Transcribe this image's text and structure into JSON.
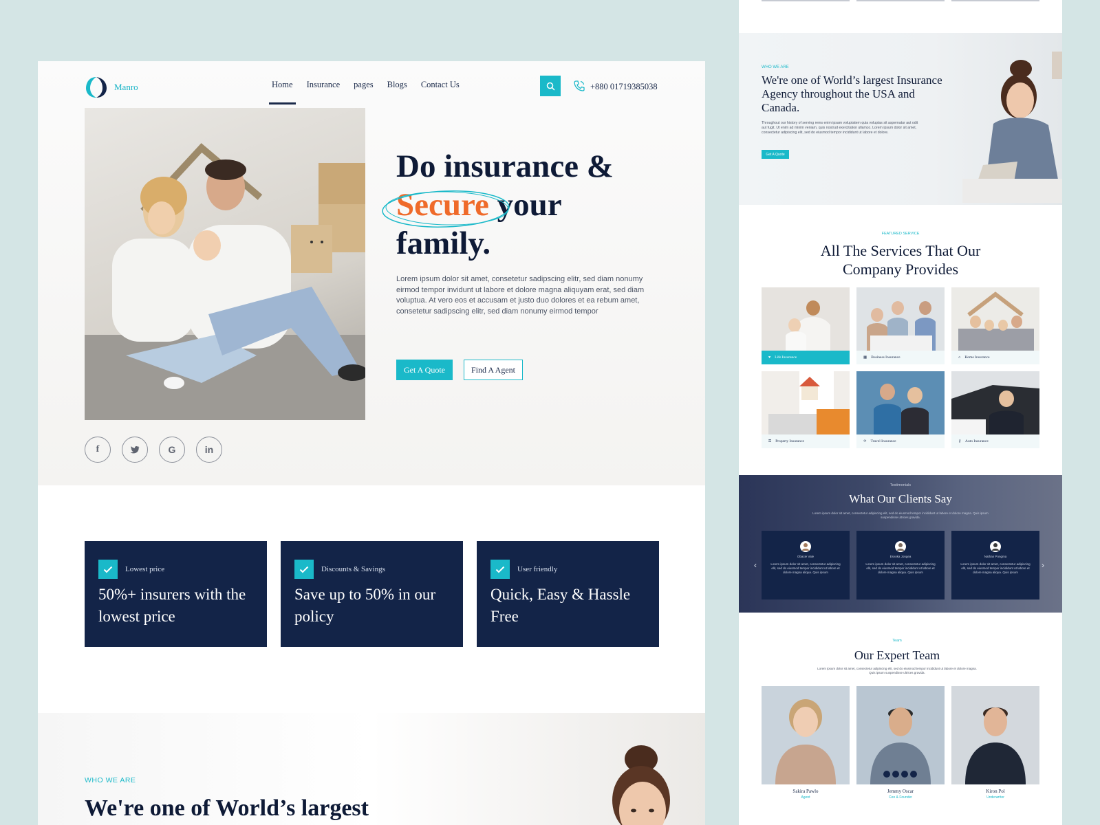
{
  "brand": {
    "name": "Manro",
    "accent": "#1ab9c9",
    "navy": "#132448",
    "orange": "#ef6a2a"
  },
  "nav": {
    "links": [
      "Home",
      "Insurance",
      "pages",
      "Blogs",
      "Contact Us"
    ],
    "phone": "+880 01719385038"
  },
  "hero": {
    "title_line1": "Do insurance &",
    "title_secure": "Secure",
    "title_your": " your",
    "title_line3": "family.",
    "description": "Lorem ipsum dolor sit amet, consetetur sadipscing elitr, sed diam nonumy eirmod tempor invidunt ut labore et dolore magna aliquyam erat, sed diam voluptua. At vero eos et accusam et justo duo dolores et ea rebum amet, consetetur sadipscing elitr, sed diam nonumy eirmod tempor",
    "btn_quote": "Get A Quote",
    "btn_agent": "Find A Agent"
  },
  "social": [
    "f",
    "t",
    "G",
    "in"
  ],
  "features": [
    {
      "tag": "Lowest price",
      "title": "50%+  insurers with the lowest price"
    },
    {
      "tag": "Discounts & Savings",
      "title": "Save up to 50% in our policy"
    },
    {
      "tag": "User friendly",
      "title": "Quick, Easy & Hassle Free"
    }
  ],
  "who": {
    "tag": "WHO WE ARE",
    "title": "We're one of  World’s largest"
  },
  "right": {
    "who_tag": "WHO WE ARE",
    "who_title": "We're one of  World’s largest Insurance Agency throughout the USA and Canada.",
    "who_desc": "Throughout our history of serving rems enim ipsam voluptatem quia voluptas sit aspernatur aut odit aut fugit. Ut enim ad minim veniam, quis nostrud exercitation ullamco. Lorem ipsum dolor sit amet, consectetur adipiscing elit, sed do eiusmod tempor incididunt ut labore et dolore.",
    "who_btn": "Get A Quote",
    "services_tag": "FEATURED SERVICE",
    "services_title": "All The Services That Our Company Provides",
    "services": [
      "Life Insurance",
      "Business Insurance",
      "Home Insurance",
      "Property Insurance",
      "Travel Insurance",
      "Auto Insurance"
    ],
    "testimonials_tag": "Testimonials",
    "testimonials_title": "What Our Clients Say",
    "testimonials_sub": "Lorem ipsum dolor sit amet, consectetur adipiscing elit, sed do eiusmod tempor incididunt ut labore et dolore magna. Quis ipsum suspendisse ultrices gravida.",
    "testimonials": [
      {
        "name": "Obacie Vale",
        "text": "Lorem ipsum dolor sit amet, consectetur adipiscing elit, sed do eiusmod tempor incididunt ut labore et dolore magna aliqua. Quis ipsum"
      },
      {
        "name": "Esvoka Jongea",
        "text": "Lorem ipsum dolor sit amet, consectetur adipiscing elit, sed do eiusmod tempor incididunt ut labore et dolore magna aliqua. Quis ipsum"
      },
      {
        "name": "Nathan Pongma",
        "text": "Lorem ipsum dolor sit amet, consectetur adipiscing elit, sed do eiusmod tempor incididunt ut labore et dolore magna aliqua. Quis ipsum"
      }
    ],
    "team_tag": "Team",
    "team_title": "Our Expert Team",
    "team_sub": "Lorem ipsum dolor sit amet, consectetur adipiscing elit, sed do eiusmod tempor incididunt ut labore et dolore magna. Quis ipsum suspendisse ultrices gravida.",
    "team": [
      {
        "name": "Sakira Pawlo",
        "role": "Agent"
      },
      {
        "name": "Jemmy Oscar",
        "role": "Ceo & Founder"
      },
      {
        "name": "Kiron Pol",
        "role": "Underwriter"
      }
    ]
  }
}
